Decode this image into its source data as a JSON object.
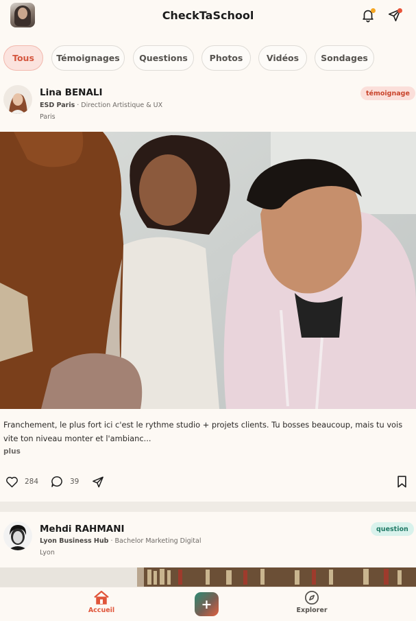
{
  "app": {
    "title": "CheckTaSchool"
  },
  "header": {
    "notifications_dot_color": "#f5a623",
    "send_dot_color": "#e8543a"
  },
  "filters": [
    {
      "label": "Tous",
      "active": true
    },
    {
      "label": "Témoignages",
      "active": false
    },
    {
      "label": "Questions",
      "active": false
    },
    {
      "label": "Photos",
      "active": false
    },
    {
      "label": "Vidéos",
      "active": false
    },
    {
      "label": "Sondages",
      "active": false
    }
  ],
  "posts": [
    {
      "author": "Lina BENALI",
      "school": "ESD Paris",
      "program": " · Direction Artistique & UX",
      "city": "Paris",
      "badge": "témoignage",
      "text": "Franchement, le plus fort ici c'est le rythme studio + projets clients. Tu bosses beaucoup, mais tu vois vite ton niveau monter et l'ambianc...",
      "more": "plus",
      "likes": "284",
      "comments": "39"
    },
    {
      "author": "Mehdi RAHMANI",
      "school": "Lyon Business Hub",
      "program": " · Bachelor Marketing Digital",
      "city": "Lyon",
      "badge": "question"
    }
  ],
  "nav": {
    "home": "Accueil",
    "explore": "Explorer",
    "create": "+"
  },
  "colors": {
    "accent": "#e0553a",
    "background": "#fdf9f4",
    "chip_active_bg": "#fbe3de",
    "badge_question_bg": "#d9f2ec"
  }
}
